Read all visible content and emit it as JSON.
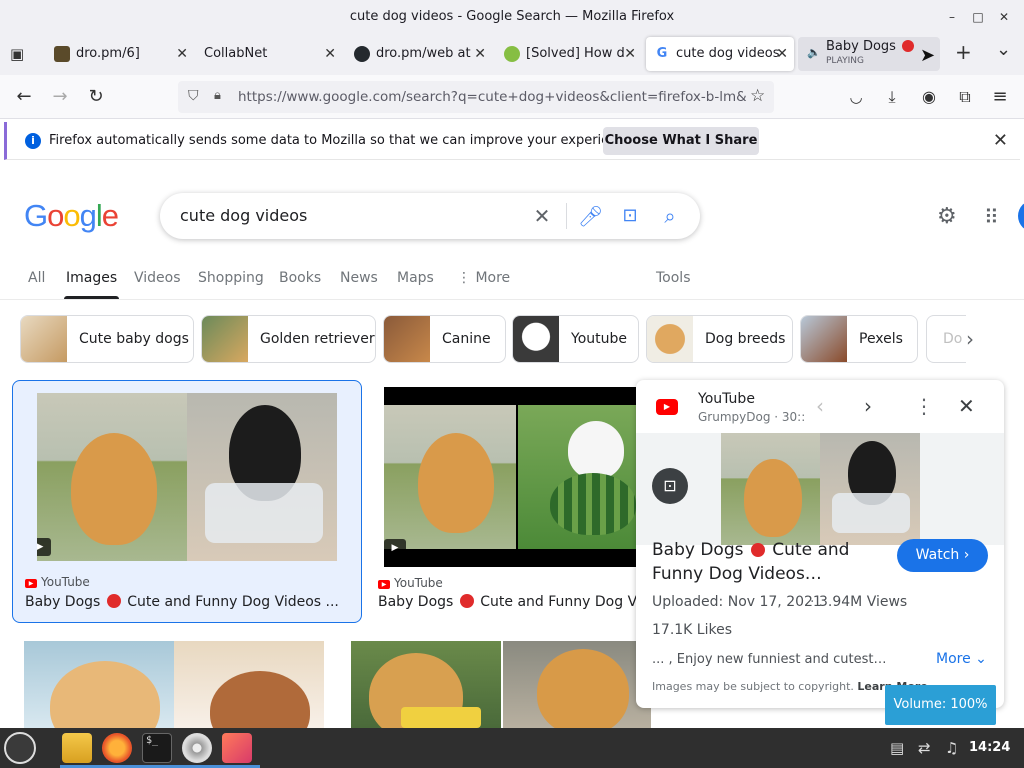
{
  "window": {
    "title": "cute dog videos - Google Search — Mozilla Firefox",
    "minimize": "–",
    "maximize": "□",
    "close": "✕"
  },
  "tabs": [
    {
      "label": "dro.pm/6]",
      "close": "✕"
    },
    {
      "label": "CollabNet",
      "close": "✕"
    },
    {
      "label": "dro.pm/web at",
      "close": "✕"
    },
    {
      "label": "[Solved] How d",
      "close": "✕"
    },
    {
      "label": "cute dog videos",
      "close": "✕"
    },
    {
      "label": "Baby Dogs",
      "status": "PLAYING"
    }
  ],
  "navbar": {
    "back": "←",
    "forward": "→",
    "reload": "↻",
    "url": "https://www.google.com/search?q=cute+dog+videos&client=firefox-b-lm&sca_e",
    "new_tab": "+",
    "tab_list": "⌄",
    "menu": "≡"
  },
  "notification": {
    "icon": "i",
    "message": "Firefox automatically sends some data to Mozilla so that we can improve your experience.",
    "button": "Choose What I Share",
    "close": "✕"
  },
  "google": {
    "logo_letters": [
      "G",
      "o",
      "o",
      "g",
      "l",
      "e"
    ],
    "logo_colors": [
      "#4285f4",
      "#ea4335",
      "#fbbc05",
      "#4285f4",
      "#34a853",
      "#ea4335"
    ],
    "query": "cute dog videos",
    "clear": "✕"
  },
  "filters": [
    {
      "label": "All",
      "active": false
    },
    {
      "label": "Images",
      "active": true
    },
    {
      "label": "Videos",
      "active": false
    },
    {
      "label": "Shopping",
      "active": false
    },
    {
      "label": "Books",
      "active": false
    },
    {
      "label": "News",
      "active": false
    },
    {
      "label": "Maps",
      "active": false
    },
    {
      "label": "⋮ More",
      "active": false
    },
    {
      "label": "Tools",
      "active": false
    }
  ],
  "chips": [
    {
      "label": "Cute baby dogs"
    },
    {
      "label": "Golden retriever"
    },
    {
      "label": "Canine"
    },
    {
      "label": "Youtube"
    },
    {
      "label": "Dog breeds"
    },
    {
      "label": "Pexels"
    },
    {
      "label": "Do"
    }
  ],
  "results": [
    {
      "source": "YouTube",
      "title_before": "Baby Dogs",
      "title_after": "Cute and Funny Dog Videos ..."
    },
    {
      "source": "YouTube",
      "title_before": "Baby Dogs",
      "title_after": "Cute and Funny Dog Vide"
    }
  ],
  "panel": {
    "source": "YouTube",
    "channel": "GrumpyDog · 30::",
    "video_title_before": "Baby Dogs",
    "video_title_after": "Cute and Funny Dog Videos…",
    "watch": "Watch ›",
    "uploaded": "Uploaded: Nov 17, 2021",
    "views": "3.94M Views",
    "likes": "17.1K Likes",
    "snippet": "... , Enjoy new funniest and cutest…",
    "more": "More ⌄",
    "copyright": "Images may be subject to copyright.",
    "learn_more": "Learn More"
  },
  "volume": "Volume: 100%",
  "taskbar": {
    "clock": "14:24",
    "terminal_label": "$_"
  },
  "colors": {
    "accent_blue": "#1a73e8",
    "youtube_red": "#ff0000",
    "taskbar": "#2f2f2f",
    "volume_osd": "#2b9fd6"
  }
}
